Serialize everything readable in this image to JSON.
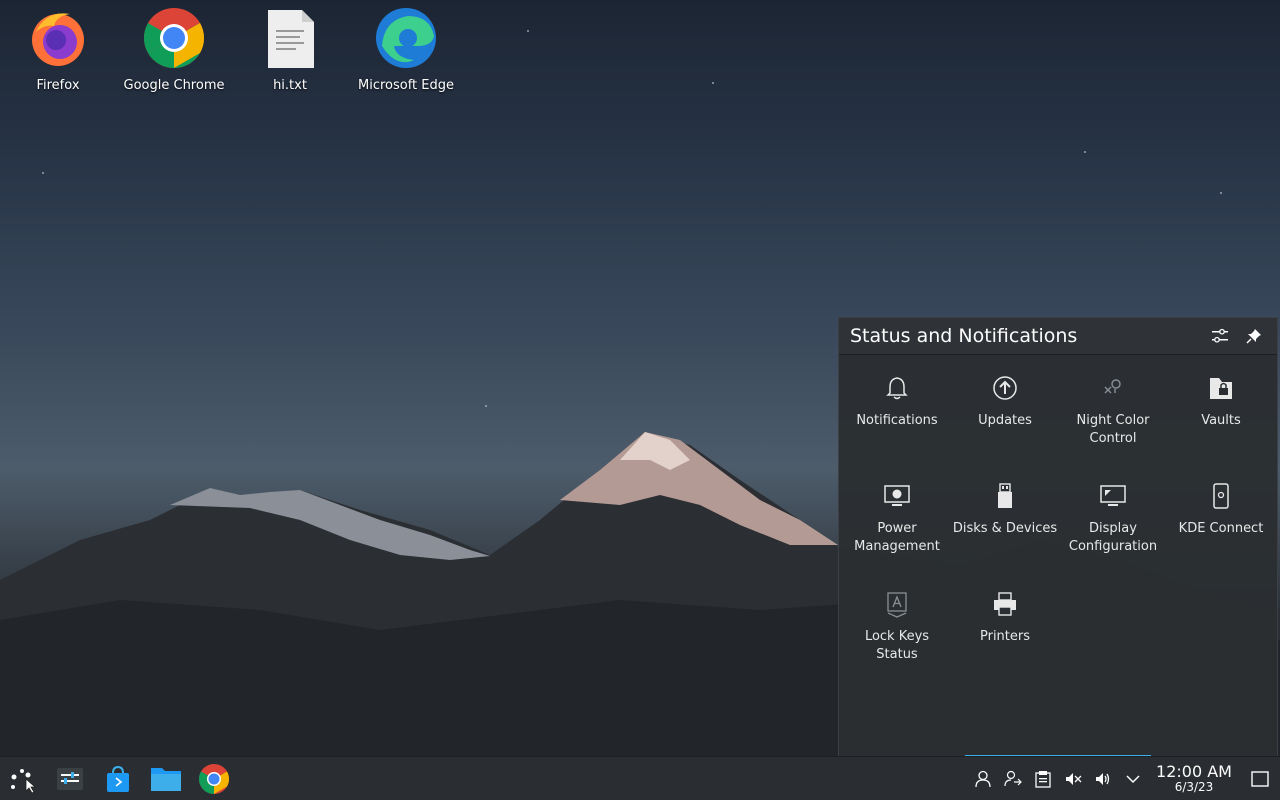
{
  "desktop": {
    "icons": [
      {
        "label": "Firefox",
        "icon": "firefox-icon"
      },
      {
        "label": "Google Chrome",
        "icon": "chrome-icon"
      },
      {
        "label": "hi.txt",
        "icon": "text-file-icon"
      },
      {
        "label": "Microsoft Edge",
        "icon": "edge-icon"
      }
    ]
  },
  "popup": {
    "title": "Status and Notifications",
    "configure_icon": "configure-icon",
    "pin_icon": "pin-icon",
    "items": [
      {
        "label": "Notifications",
        "icon": "bell-icon"
      },
      {
        "label": "Updates",
        "icon": "update-icon"
      },
      {
        "label": "Night Color Control",
        "icon": "night-color-icon"
      },
      {
        "label": "Vaults",
        "icon": "vault-icon"
      },
      {
        "label": "Power Management",
        "icon": "power-management-icon"
      },
      {
        "label": "Disks & Devices",
        "icon": "usb-drive-icon"
      },
      {
        "label": "Display Configuration",
        "icon": "display-icon"
      },
      {
        "label": "KDE Connect",
        "icon": "phone-icon"
      },
      {
        "label": "Lock Keys Status",
        "icon": "lock-keys-icon"
      },
      {
        "label": "Printers",
        "icon": "printer-icon"
      }
    ]
  },
  "taskbar": {
    "launchers": [
      "app-launcher-icon",
      "system-settings-icon",
      "discover-store-icon",
      "file-manager-icon",
      "chrome-icon"
    ],
    "tray": [
      "user-icon",
      "user-switch-icon",
      "clipboard-icon",
      "mute-icon",
      "volume-icon",
      "expand-tray-icon"
    ],
    "clock": {
      "time": "12:00 AM",
      "date": "6/3/23"
    },
    "show_desktop_icon": "show-desktop-icon"
  },
  "colors": {
    "accent": "#3daee9",
    "panel_bg": "#2a2e32",
    "popup_bg": "#2f3338"
  }
}
